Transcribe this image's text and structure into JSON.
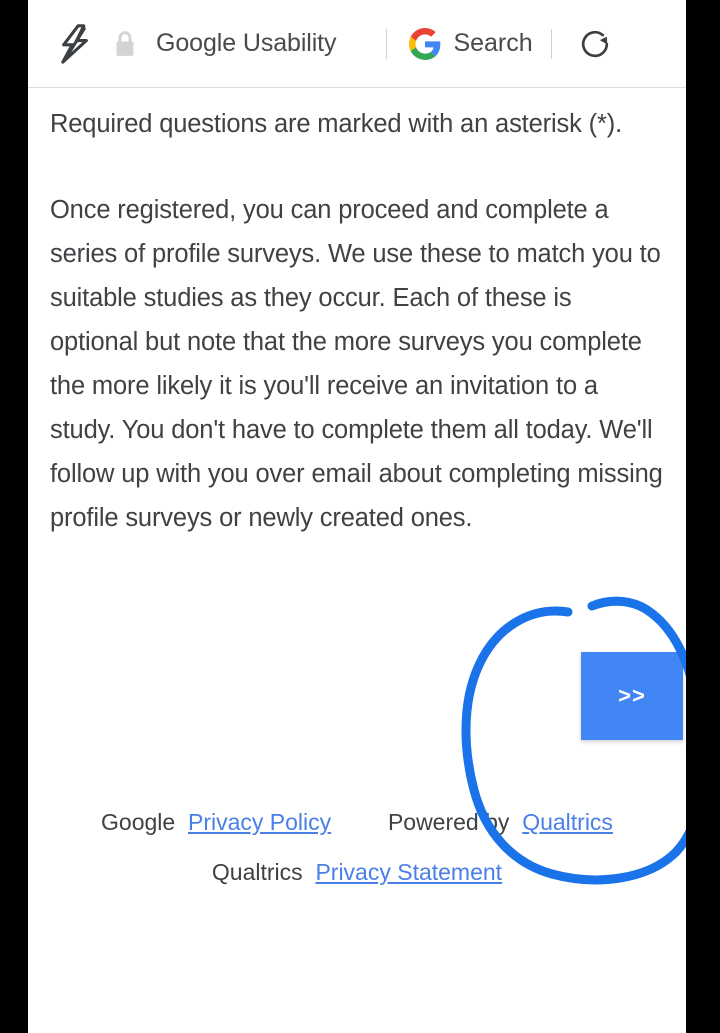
{
  "browser_header": {
    "amp_icon": "lightning-bolt-icon",
    "lock_icon": "lock-icon",
    "site_title": "Google Usability",
    "google_logo": "google-g-logo",
    "search_label": "Search",
    "reload_icon": "reload-icon"
  },
  "content": {
    "paragraph_1": "Required questions are marked with an asterisk (*).",
    "paragraph_2": "Once registered, you can proceed and complete a series of profile surveys. We use these to match you to suitable studies as they occur. Each of these is optional but note that the more surveys you complete the more likely it is you'll receive an invitation to a study. You don't have to complete them all today. We'll follow up with you over email about completing missing profile surveys or newly created ones.",
    "next_button_label": ">>"
  },
  "footer": {
    "google_prefix": "Google",
    "google_privacy_link": "Privacy Policy",
    "powered_by": "Powered by",
    "qualtrics_link": "Qualtrics",
    "qualtrics_prefix": "Qualtrics",
    "qualtrics_privacy_link": "Privacy Statement"
  },
  "annotation": {
    "type": "hand-drawn-circle",
    "color": "#1a73e8",
    "target": "next-button"
  },
  "colors": {
    "button_blue": "#4285f4",
    "link_blue": "#4a7fe8",
    "text_gray": "#3f4245",
    "annotation_blue": "#1a73e8",
    "letterbox": "#000000"
  }
}
